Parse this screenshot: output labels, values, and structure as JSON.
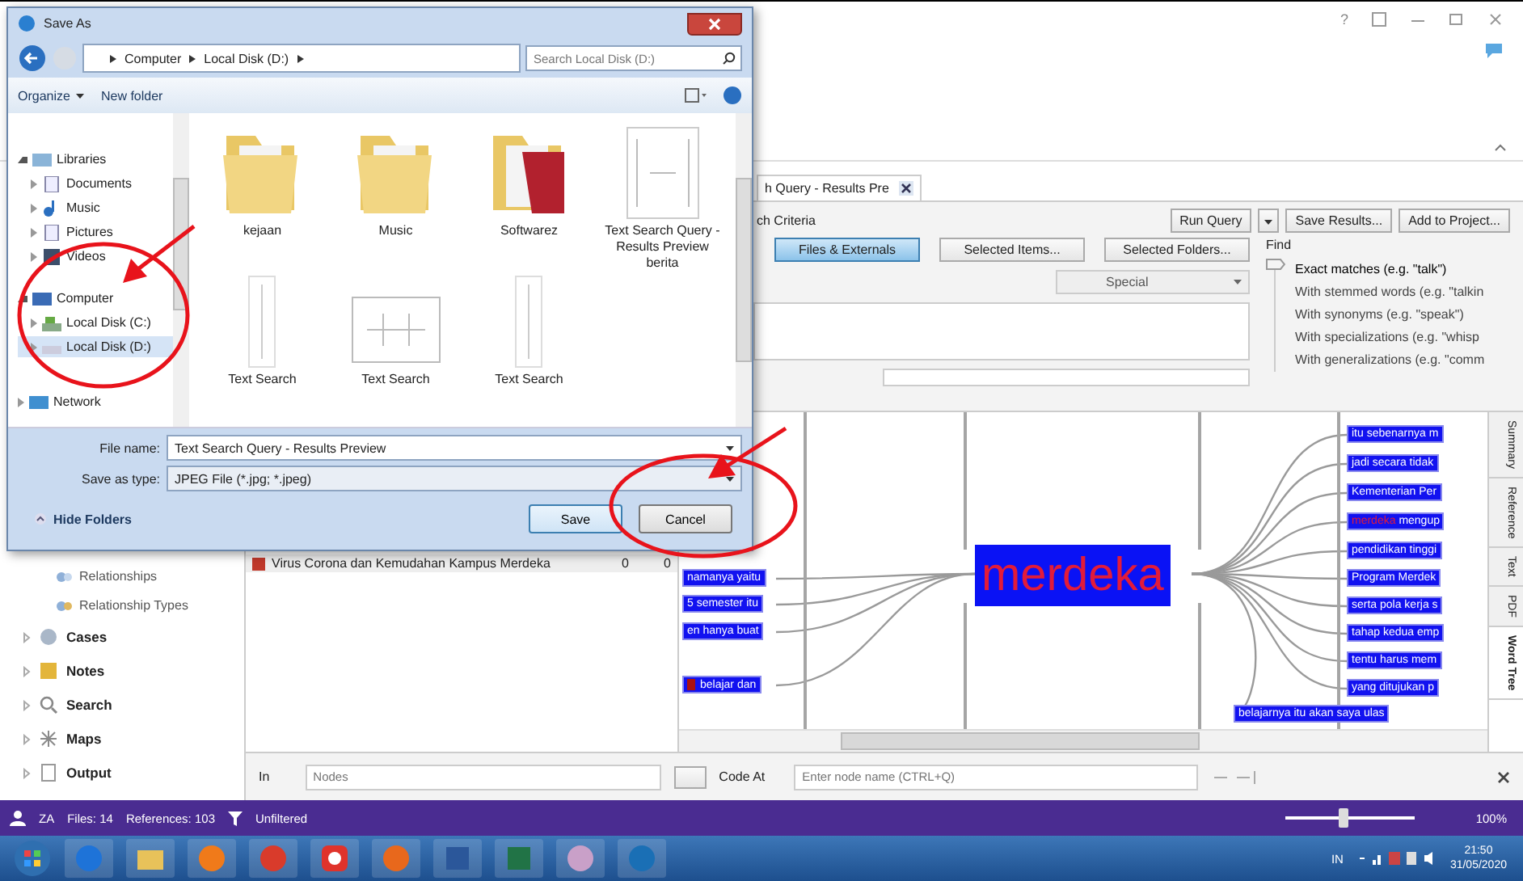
{
  "app": {
    "help": "?"
  },
  "dialog": {
    "title": "Save As",
    "breadcrumb": [
      "Computer",
      "Local Disk (D:)"
    ],
    "search": {
      "placeholder": "Search Local Disk (D:)"
    },
    "organize": "Organize",
    "new_folder": "New folder",
    "nav": [
      {
        "label": "Libraries",
        "kind": "library",
        "expanded": true,
        "selected": false,
        "children": [
          {
            "label": "Documents",
            "kind": "documents",
            "expanded": false,
            "selected": false
          },
          {
            "label": "Music",
            "kind": "music",
            "expanded": false,
            "selected": false
          },
          {
            "label": "Pictures",
            "kind": "pictures",
            "expanded": false,
            "selected": false
          },
          {
            "label": "Videos",
            "kind": "videos",
            "expanded": false,
            "selected": false
          }
        ]
      },
      {
        "label": "Computer",
        "kind": "computer",
        "expanded": true,
        "selected": false,
        "children": [
          {
            "label": "Local Disk (C:)",
            "kind": "system-disk",
            "expanded": false,
            "selected": false
          },
          {
            "label": "Local Disk (D:)",
            "kind": "disk",
            "expanded": false,
            "selected": true
          }
        ]
      },
      {
        "label": "Network",
        "kind": "network",
        "expanded": false,
        "selected": false
      }
    ],
    "files": [
      {
        "name": "kejaan",
        "kind": "folder"
      },
      {
        "name": "Music",
        "kind": "folder"
      },
      {
        "name": "Softwarez",
        "kind": "folder-red"
      },
      {
        "name": "Text Search Query - Results Preview berita",
        "kind": "tree-image"
      },
      {
        "name": "Text Search",
        "kind": "tall-image"
      },
      {
        "name": "Text Search",
        "kind": "wide-image"
      },
      {
        "name": "Text Search",
        "kind": "thin-image"
      }
    ],
    "file_name": {
      "label": "File name:",
      "value": "Text Search Query - Results Preview"
    },
    "save_type": {
      "label": "Save as type:",
      "value": "JPEG File (*.jpg; *.jpeg)"
    },
    "hide_folders": "Hide Folders",
    "buttons": [
      {
        "label": "Save",
        "default": true
      },
      {
        "label": "Cancel",
        "default": false
      }
    ]
  },
  "nav": {
    "sub_items": [
      {
        "label": "Relationships",
        "kind": "relationships"
      },
      {
        "label": "Relationship Types",
        "kind": "relationship-types"
      }
    ],
    "sections": [
      {
        "label": "Cases",
        "kind": "cases"
      },
      {
        "label": "Notes",
        "kind": "notes"
      },
      {
        "label": "Search",
        "kind": "search"
      },
      {
        "label": "Maps",
        "kind": "maps"
      },
      {
        "label": "Output",
        "kind": "output"
      }
    ]
  },
  "query": {
    "tab": {
      "label": "h Query - Results Pre",
      "selected": true
    },
    "criteria_label": "ch Criteria",
    "actions": [
      "Run Query",
      "Save Results...",
      "Add to Project..."
    ],
    "scope_buttons": [
      {
        "label": "Files & Externals",
        "selected": true
      },
      {
        "label": "Selected Items...",
        "selected": false
      },
      {
        "label": "Selected Folders...",
        "selected": false
      }
    ],
    "special": "Special",
    "find_label": "Find",
    "find_options": [
      {
        "label": "Exact matches (e.g. \"talk\")",
        "selected": true
      },
      {
        "label": "With stemmed words (e.g. \"talkin",
        "selected": false
      },
      {
        "label": "With synonyms (e.g. \"speak\")",
        "selected": false
      },
      {
        "label": "With specializations (e.g. \"whisp",
        "selected": false
      },
      {
        "label": "With generalizations (e.g. \"comm",
        "selected": false
      }
    ]
  },
  "results": [
    {
      "name": "Virus Corona dan Kemudahan Kampus Merdeka",
      "column_2": "0",
      "column_3": "0"
    }
  ],
  "word_tree": {
    "root": "merdeka",
    "left": [
      {
        "text": "namanya yaitu",
        "cut_keyword": false
      },
      {
        "text": "5 semester itu",
        "cut_keyword": false
      },
      {
        "text": "en hanya buat",
        "cut_keyword": false
      },
      {
        "text": "belajar dan",
        "cut_keyword": true
      }
    ],
    "right": [
      {
        "parts": [
          {
            "text": "itu sebenarnya m",
            "keyword": false
          }
        ]
      },
      {
        "parts": [
          {
            "text": "jadi secara tidak",
            "keyword": false
          }
        ]
      },
      {
        "parts": [
          {
            "text": "Kementerian Per",
            "keyword": false
          }
        ]
      },
      {
        "parts": [
          {
            "text": "merdeka",
            "keyword": true
          },
          {
            "text": "mengup",
            "keyword": false
          }
        ]
      },
      {
        "parts": [
          {
            "text": "pendidikan tinggi",
            "keyword": false
          }
        ]
      },
      {
        "parts": [
          {
            "text": "Program Merdek",
            "keyword": false
          }
        ]
      },
      {
        "parts": [
          {
            "text": "serta pola kerja s",
            "keyword": false
          }
        ]
      },
      {
        "parts": [
          {
            "text": "tahap kedua emp",
            "keyword": false
          }
        ]
      },
      {
        "parts": [
          {
            "text": "tentu harus mem",
            "keyword": false
          }
        ]
      },
      {
        "parts": [
          {
            "text": "yang ditujukan p",
            "keyword": false
          }
        ]
      },
      {
        "parts": [
          {
            "text": "belajarnya itu akan saya ulas",
            "keyword": false
          }
        ]
      }
    ]
  },
  "side_tabs": [
    {
      "label": "Summary",
      "selected": false
    },
    {
      "label": "Reference",
      "selected": false
    },
    {
      "label": "Text",
      "selected": false
    },
    {
      "label": "PDF",
      "selected": false
    },
    {
      "label": "Word Tree",
      "selected": true
    }
  ],
  "bottom_bar": {
    "in_label": "In",
    "nodes": {
      "placeholder": "Nodes"
    },
    "code_at_label": "Code At",
    "node_name": {
      "placeholder": "Enter node name (CTRL+Q)"
    }
  },
  "status_bar": {
    "user": "ZA",
    "files": "Files: 14",
    "references": "References: 103",
    "filter": "Unfiltered",
    "zoom": {
      "level": 0.45,
      "reading": "100%"
    }
  },
  "taskbar": {
    "apps": [
      {
        "kind": "browser-e"
      },
      {
        "kind": "folder"
      },
      {
        "kind": "player"
      },
      {
        "kind": "chrome"
      },
      {
        "kind": "camera"
      },
      {
        "kind": "firefox"
      },
      {
        "kind": "word"
      },
      {
        "kind": "excel"
      },
      {
        "kind": "paint"
      },
      {
        "kind": "app"
      }
    ],
    "language": "IN",
    "time": "21:50",
    "date": "31/05/2020"
  }
}
